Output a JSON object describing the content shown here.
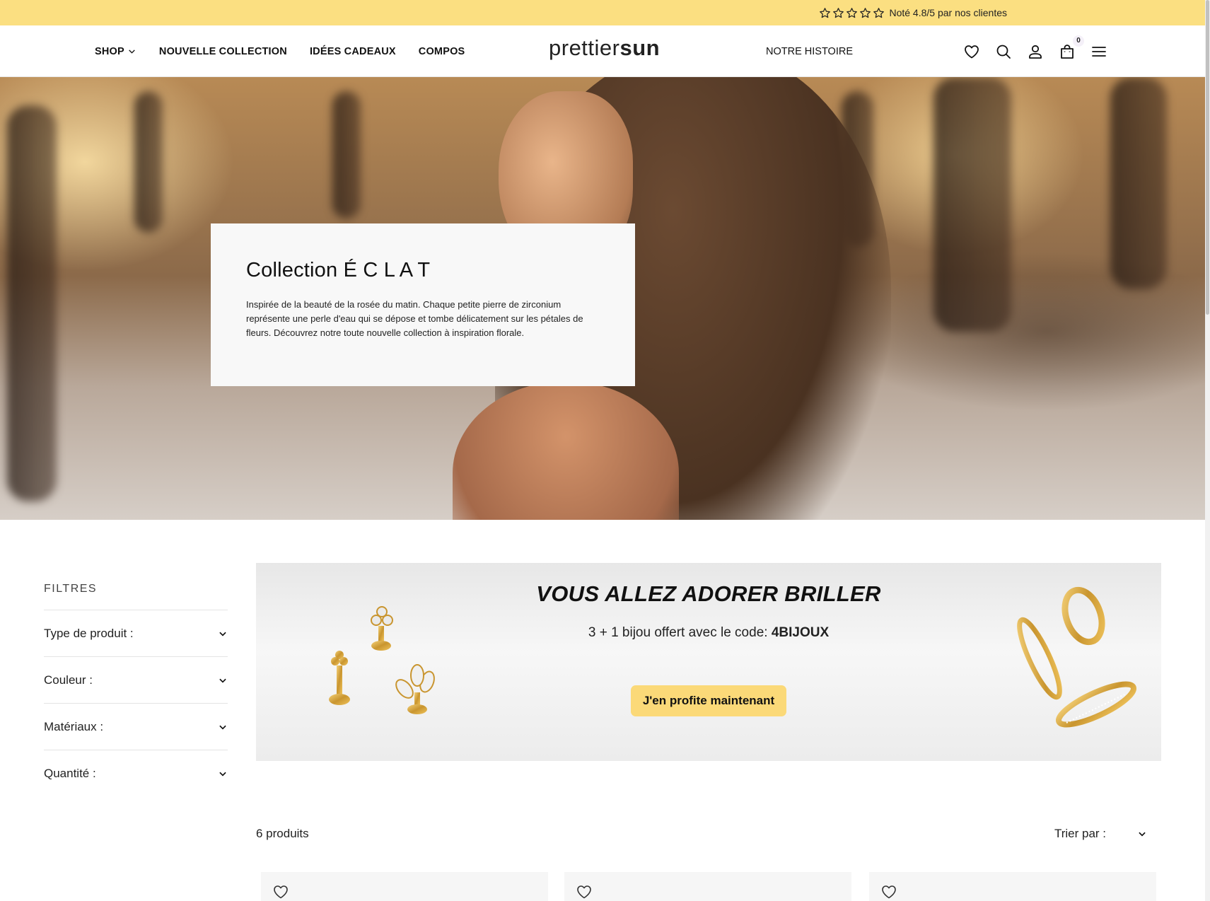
{
  "colors": {
    "announcement_bg": "#fbdf81",
    "cta_bg": "#fbd978",
    "promo_bg": "#efefef",
    "text": "#111111"
  },
  "announcement": {
    "rating_stars": 5,
    "text": "Noté 4.8/5 par nos clientes"
  },
  "header": {
    "nav": [
      {
        "label": "SHOP",
        "has_dropdown": true
      },
      {
        "label": "NOUVELLE COLLECTION"
      },
      {
        "label": "IDÉES CADEAUX"
      },
      {
        "label": "COMPOS"
      }
    ],
    "logo": {
      "light": "prettier",
      "bold": "sun"
    },
    "story_link": "NOTRE HISTOIRE",
    "icons": [
      "heart-icon",
      "search-icon",
      "user-icon",
      "bag-icon",
      "menu-icon"
    ],
    "cart_count": "0"
  },
  "hero": {
    "title": "Collection É C L A T",
    "description": "Inspirée de la beauté de la rosée du matin. Chaque petite pierre de zirconium représente une perle d'eau qui se dépose et tombe délicatement sur les pétales de fleurs. Découvrez notre toute nouvelle collection à inspiration florale."
  },
  "filters": {
    "title": "FILTRES",
    "items": [
      {
        "label": "Type de produit :"
      },
      {
        "label": "Couleur :"
      },
      {
        "label": "Matériaux :"
      },
      {
        "label": "Quantité :"
      }
    ]
  },
  "promo": {
    "headline": "VOUS ALLEZ ADORER BRILLER",
    "sub_text": "3 + 1 bijou offert avec le code: ",
    "code": "4BIJOUX",
    "cta_label": "J'en profite maintenant"
  },
  "products": {
    "count_label": "6 produits",
    "sort_label": "Trier par :"
  }
}
